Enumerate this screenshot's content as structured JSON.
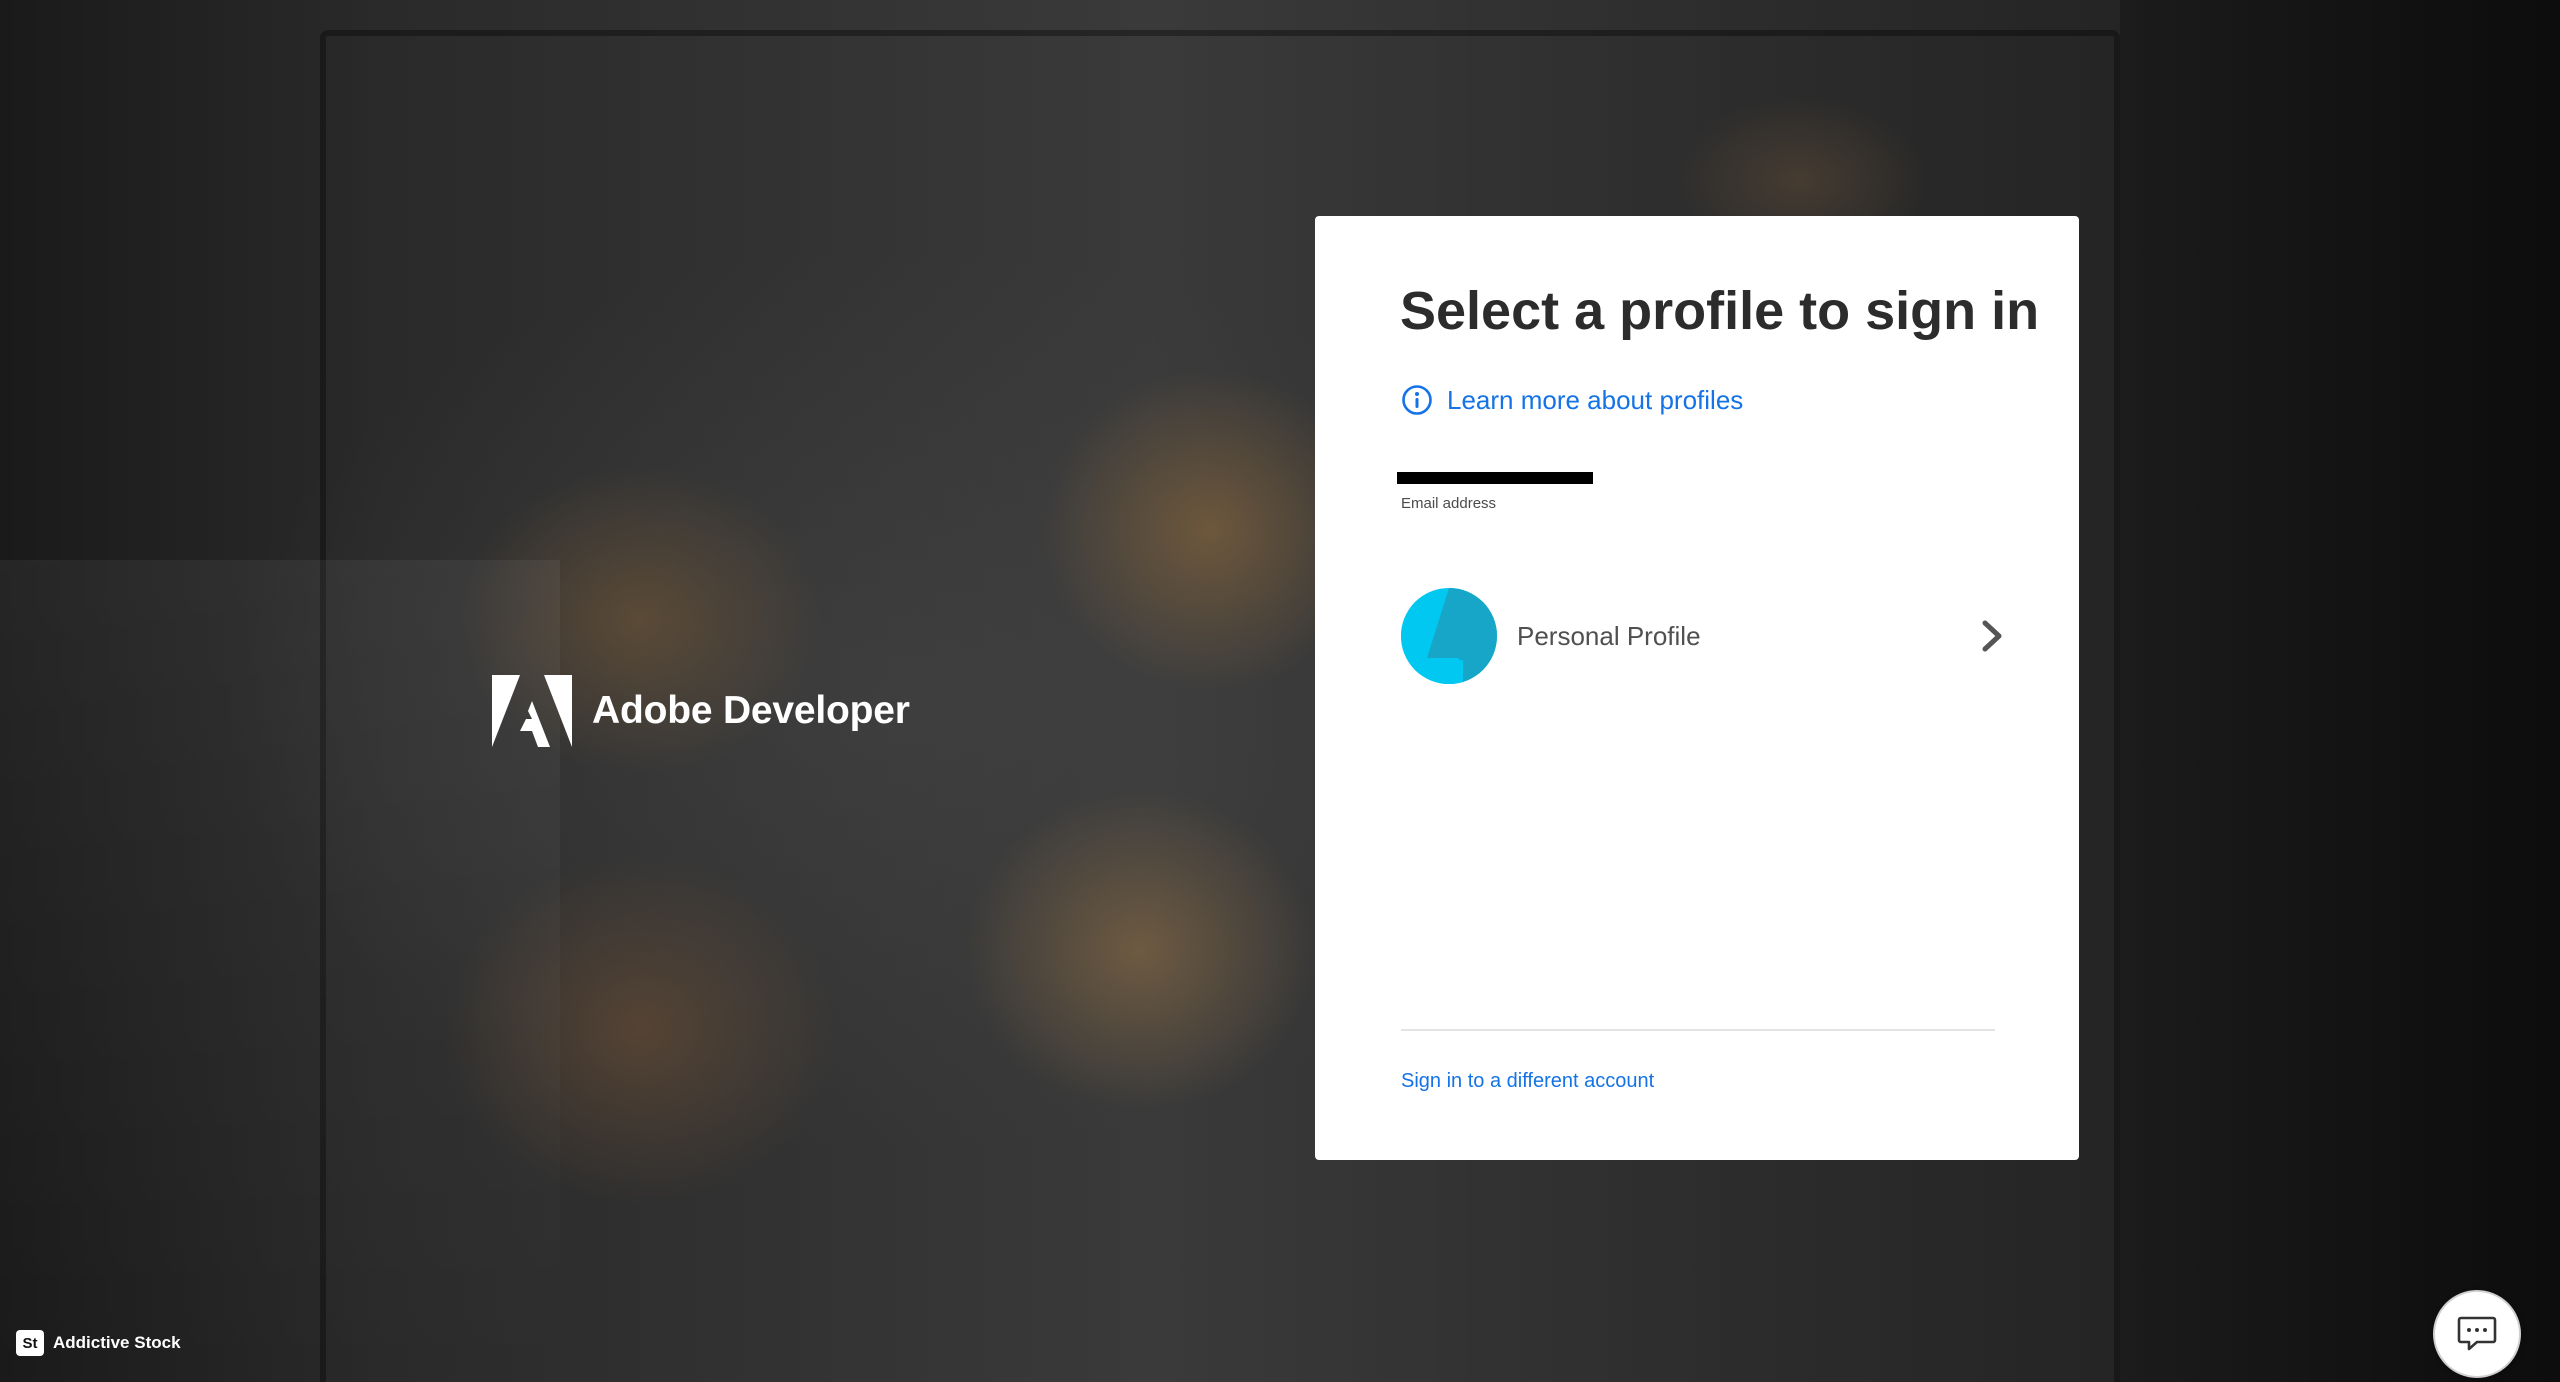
{
  "brand": {
    "name": "Adobe Developer",
    "logo_icon": "adobe-logo-icon"
  },
  "card": {
    "title": "Select a profile to sign in",
    "learn_more": {
      "icon": "info-icon",
      "label": "Learn more about profiles"
    },
    "email": {
      "label": "Email address",
      "value_redacted": true
    },
    "profiles": [
      {
        "name": "Personal Profile",
        "avatar_color": "#00c8f0",
        "avatar_shadow_color": "#18a6c8",
        "chevron_icon": "chevron-right-icon"
      }
    ],
    "alt_sign_in": "Sign in to a different account"
  },
  "credit": {
    "badge": "St",
    "label": "Addictive Stock"
  },
  "chat": {
    "icon": "chat-icon"
  },
  "colors": {
    "link": "#1473e6",
    "title": "#2c2c2c",
    "card_bg": "#ffffff"
  }
}
